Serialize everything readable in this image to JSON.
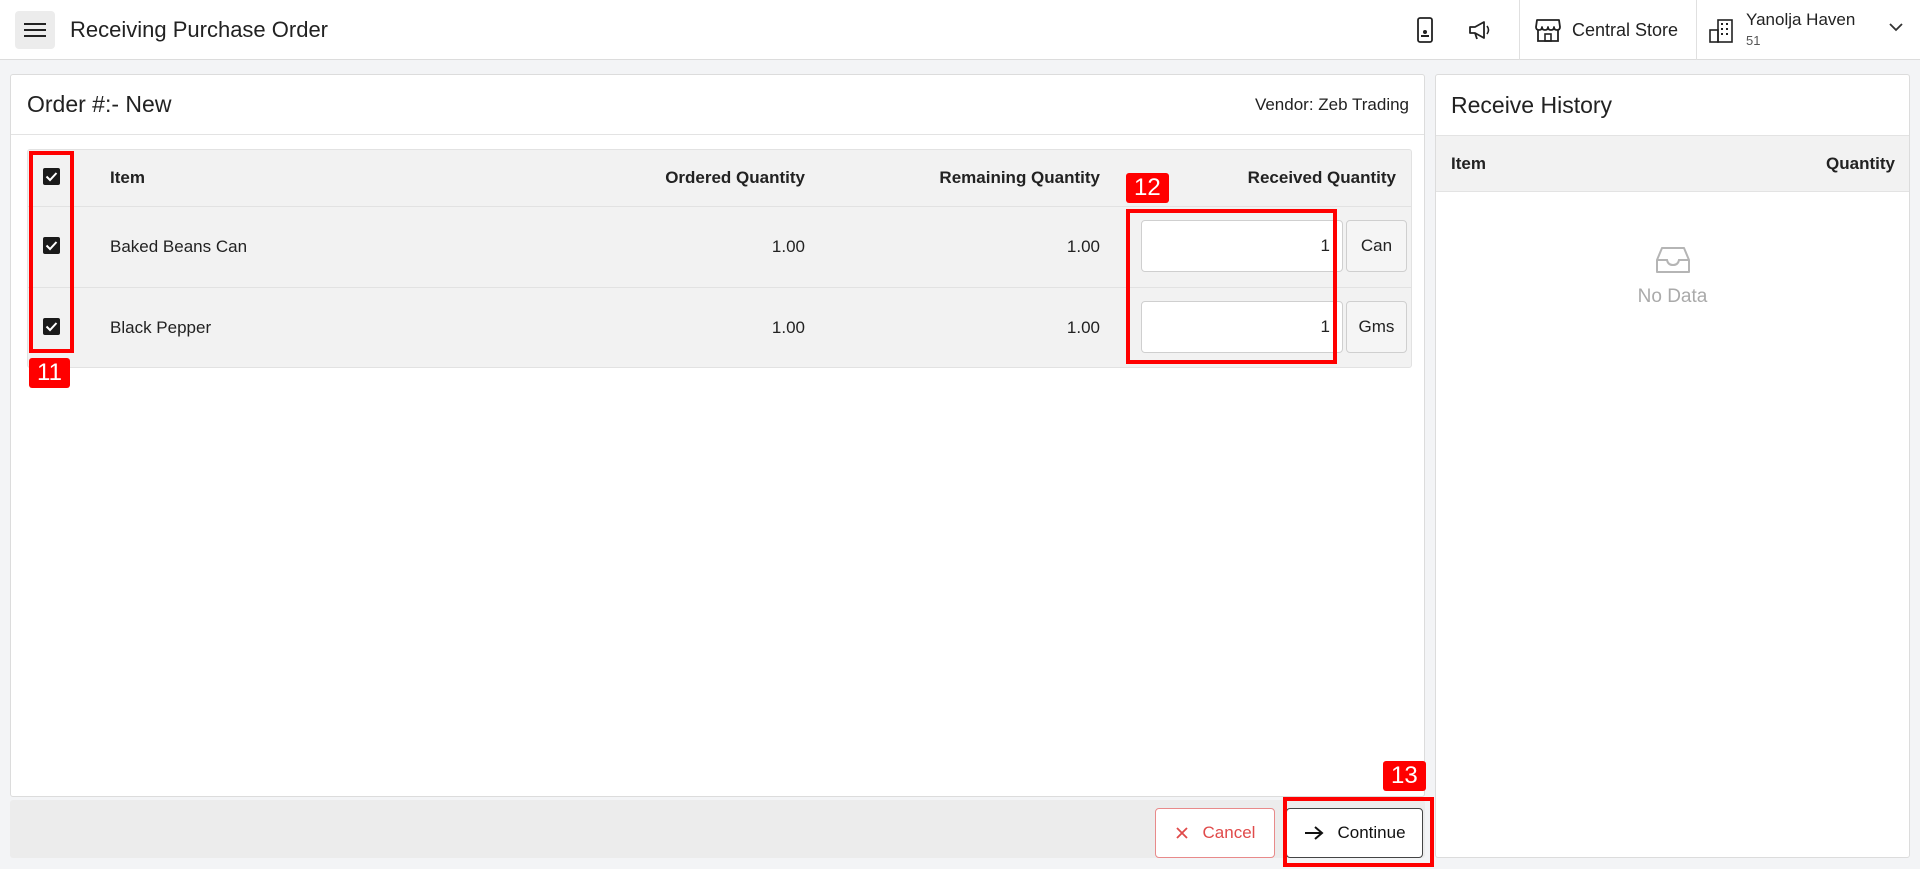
{
  "header": {
    "title": "Receiving Purchase Order",
    "icons": [
      "menu-icon",
      "mobile-icon",
      "megaphone-icon",
      "store-icon",
      "building-icon",
      "chevron-down-icon"
    ],
    "store_name": "Central Store",
    "property_name": "Yanolja Haven",
    "property_number": "51"
  },
  "order": {
    "title": "Order #:- New",
    "vendor": "Vendor: Zeb Trading",
    "columns": {
      "item": "Item",
      "ordered": "Ordered Quantity",
      "remaining": "Remaining Quantity",
      "received": "Received Quantity"
    },
    "rows": [
      {
        "checked": true,
        "item": "Baked Beans Can",
        "ordered": "1.00",
        "remaining": "1.00",
        "received": "1",
        "unit": "Can"
      },
      {
        "checked": true,
        "item": "Black Pepper",
        "ordered": "1.00",
        "remaining": "1.00",
        "received": "1",
        "unit": "Gms"
      }
    ],
    "select_all_checked": true
  },
  "actions": {
    "cancel_label": "Cancel",
    "continue_label": "Continue"
  },
  "history": {
    "title": "Receive History",
    "col_item": "Item",
    "col_quantity": "Quantity",
    "empty_text": "No Data"
  },
  "annotations": [
    "11",
    "12",
    "13"
  ],
  "colors": {
    "annotation": "#ff0000",
    "cancel": "#e04a4a",
    "checkbox": "#1a1a1a"
  }
}
